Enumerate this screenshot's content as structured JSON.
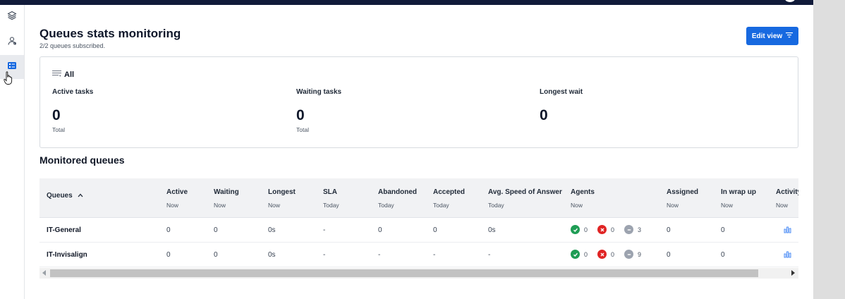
{
  "header": {
    "title": "Queues stats monitoring",
    "subtitle": "2/2 queues subscribed.",
    "edit_view_label": "Edit view"
  },
  "sidebar": {
    "items": [
      {
        "icon": "layers-icon"
      },
      {
        "icon": "agent-status-icon"
      },
      {
        "icon": "queue-stats-icon",
        "active": true
      }
    ]
  },
  "summary": {
    "filter_label": "All",
    "stats": [
      {
        "label": "Active tasks",
        "value": "0",
        "unit": "Total"
      },
      {
        "label": "Waiting tasks",
        "value": "0",
        "unit": "Total"
      },
      {
        "label": "Longest wait",
        "value": "0",
        "unit": ""
      }
    ]
  },
  "table": {
    "section_title": "Monitored queues",
    "columns": [
      {
        "label": "Queues",
        "sub": ""
      },
      {
        "label": "Active",
        "sub": "Now"
      },
      {
        "label": "Waiting",
        "sub": "Now"
      },
      {
        "label": "Longest",
        "sub": "Now"
      },
      {
        "label": "SLA",
        "sub": "Today"
      },
      {
        "label": "Abandoned",
        "sub": "Today"
      },
      {
        "label": "Accepted",
        "sub": "Today"
      },
      {
        "label": "Avg. Speed of Answer",
        "sub": "Today"
      },
      {
        "label": "Agents",
        "sub": "Now"
      },
      {
        "label": "Assigned",
        "sub": "Now"
      },
      {
        "label": "In wrap up",
        "sub": "Now"
      },
      {
        "label": "Activity",
        "sub": "Now"
      }
    ],
    "rows": [
      {
        "name": "IT-General",
        "active": "0",
        "waiting": "0",
        "longest": "0s",
        "sla": "-",
        "abandoned": "0",
        "accepted": "0",
        "asa": "0s",
        "agents_available": "0",
        "agents_unavailable": "0",
        "agents_offline": "3",
        "assigned": "0",
        "wrap_up": "0"
      },
      {
        "name": "IT-Invisalign",
        "active": "0",
        "waiting": "0",
        "longest": "0s",
        "sla": "-",
        "abandoned": "-",
        "accepted": "-",
        "asa": "-",
        "agents_available": "0",
        "agents_unavailable": "0",
        "agents_offline": "9",
        "assigned": "0",
        "wrap_up": "0"
      }
    ]
  },
  "colors": {
    "accent": "#1769e0",
    "available": "#1f9d55",
    "unavailable": "#e02424",
    "offline": "#9ca3af",
    "topbar": "#111b3a"
  }
}
